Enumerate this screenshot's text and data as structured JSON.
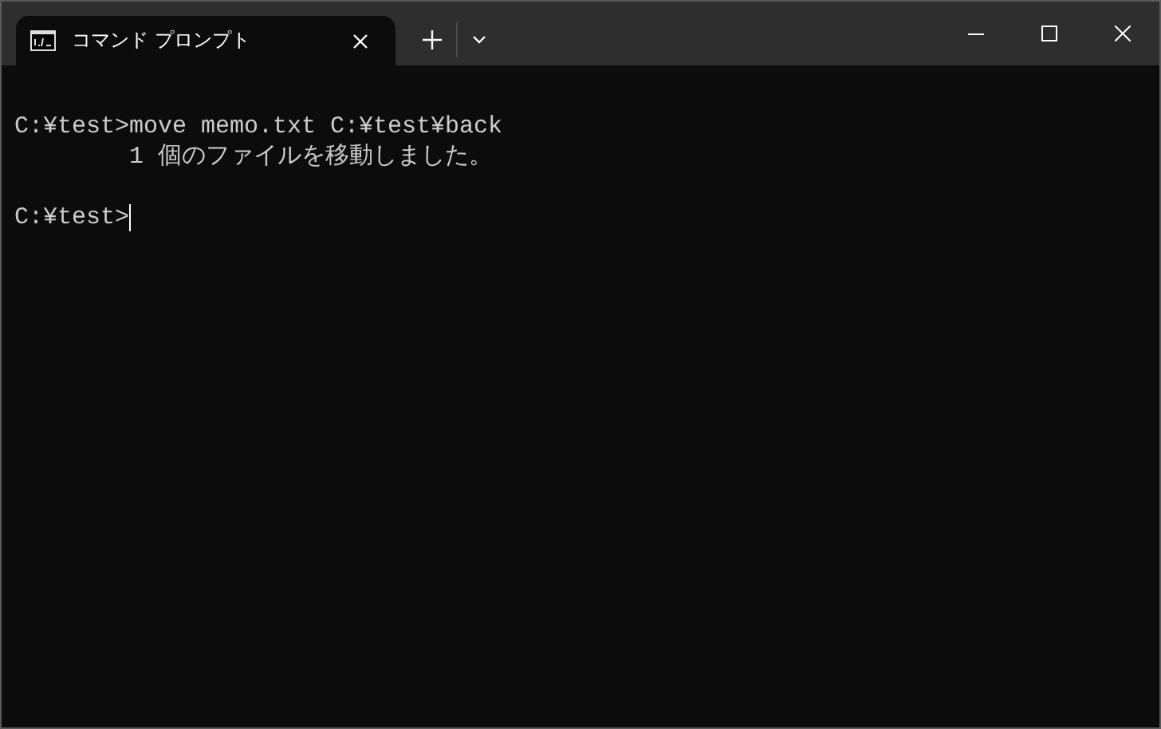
{
  "tabs": [
    {
      "title": "コマンド プロンプト",
      "selected": true
    }
  ],
  "terminal": {
    "lines": [
      {
        "text": "C:¥test>move memo.txt C:¥test¥back",
        "gap_before": false,
        "cursor": false
      },
      {
        "text": "        1 個のファイルを移動しました。",
        "gap_before": false,
        "cursor": false
      },
      {
        "text": "C:¥test>",
        "gap_before": true,
        "cursor": true
      }
    ]
  }
}
